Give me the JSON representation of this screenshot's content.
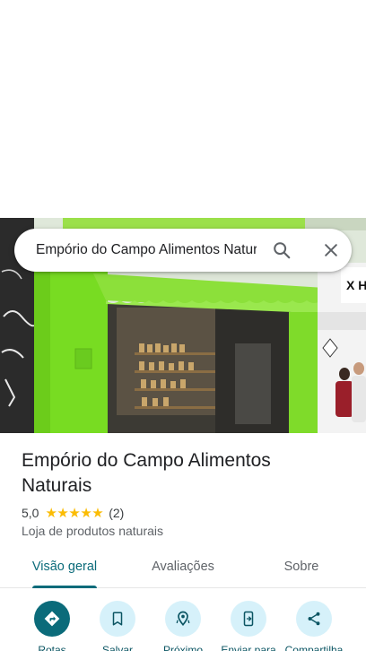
{
  "search": {
    "query": "Empório do Campo Alimentos Natur"
  },
  "place": {
    "name": "Empório do Campo Alimentos Naturais",
    "rating": "5,0",
    "review_count": "(2)",
    "star_count": 5,
    "category": "Loja de produtos naturais",
    "storefront_sign": "X HO"
  },
  "tabs": [
    {
      "label": "Visão geral",
      "active": true
    },
    {
      "label": "Avaliações",
      "active": false
    },
    {
      "label": "Sobre",
      "active": false
    }
  ],
  "actions": [
    {
      "label": "Rotas",
      "icon": "directions-icon"
    },
    {
      "label": "Salvar",
      "icon": "bookmark-icon"
    },
    {
      "label": "Próximo",
      "icon": "nearby-icon"
    },
    {
      "label": "Enviar para",
      "icon": "send-to-phone-icon"
    },
    {
      "label": "Compartilha",
      "icon": "share-icon"
    }
  ],
  "colors": {
    "accent": "#0b6b7a",
    "action_bg": "#d6f1fa",
    "star": "#fbbc04",
    "awning": "#8ce03a"
  }
}
